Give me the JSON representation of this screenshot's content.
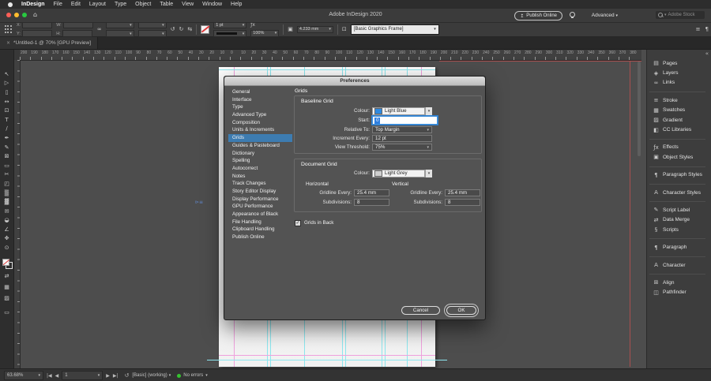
{
  "menu_bar": {
    "items": [
      "InDesign",
      "File",
      "Edit",
      "Layout",
      "Type",
      "Object",
      "Table",
      "View",
      "Window",
      "Help"
    ]
  },
  "title_bar": {
    "title": "Adobe InDesign 2020",
    "publish_online": "Publish Online",
    "advanced": "Advanced",
    "search_placeholder": "Adobe Stock"
  },
  "control_panel": {
    "x_label": "X:",
    "y_label": "Y:",
    "w_label": "W:",
    "h_label": "H:",
    "stroke_weight": "1 pt",
    "opacity": "100%",
    "corner_radius": "4.233 mm",
    "object_style": "[Basic Graphics Frame]"
  },
  "tab_bar": {
    "title": "*Untitled-1 @ 70% [GPU Preview]"
  },
  "rulers": {
    "h_numbers": [
      200,
      190,
      180,
      170,
      160,
      150,
      140,
      130,
      120,
      110,
      100,
      90,
      80,
      70,
      60,
      50,
      40,
      30,
      20,
      10,
      0,
      10,
      20,
      30,
      40,
      50,
      60,
      70,
      80,
      90,
      100,
      110,
      120,
      130,
      140,
      150,
      160,
      170,
      180,
      190,
      200,
      210,
      220,
      230,
      240,
      250,
      260,
      270,
      280,
      290,
      300,
      310,
      320,
      330,
      340,
      350,
      360,
      370,
      380
    ]
  },
  "tools": [
    "selection",
    "direct-selection",
    "page",
    "gap",
    "content-collector",
    "type",
    "line",
    "pen",
    "pencil",
    "rectangle-frame",
    "rectangle",
    "scissors",
    "free-transform",
    "gradient-swatch",
    "gradient-feather",
    "note",
    "eyedropper",
    "measure",
    "hand",
    "zoom"
  ],
  "dialog": {
    "title": "Preferences",
    "nav": {
      "items": [
        {
          "label": "General"
        },
        {
          "label": "Interface"
        },
        {
          "label": "Type"
        },
        {
          "label": "Advanced Type"
        },
        {
          "label": "Composition"
        },
        {
          "label": "Units & Increments"
        },
        {
          "label": "Grids",
          "selected": true
        },
        {
          "label": "Guides & Pasteboard"
        },
        {
          "label": "Dictionary"
        },
        {
          "label": "Spelling"
        },
        {
          "label": "Autocorrect"
        },
        {
          "label": "Notes"
        },
        {
          "label": "Track Changes"
        },
        {
          "label": "Story Editor Display"
        },
        {
          "label": "Display Performance"
        },
        {
          "label": "GPU Performance"
        },
        {
          "label": "Appearance of Black"
        },
        {
          "label": "File Handling"
        },
        {
          "label": "Clipboard Handling"
        },
        {
          "label": "Publish Online"
        }
      ]
    },
    "content": {
      "heading": "Grids",
      "baseline": {
        "title": "Baseline Grid",
        "colour_label": "Colour:",
        "colour_value": "Light Blue",
        "start_label": "Start:",
        "start_value": "0",
        "relative_label": "Relative To:",
        "relative_value": "Top Margin",
        "increment_label": "Increment Every:",
        "increment_value": "12 pt",
        "threshold_label": "View Threshold:",
        "threshold_value": "75%"
      },
      "document": {
        "title": "Document Grid",
        "colour_label": "Colour:",
        "colour_value": "Light Grey",
        "horizontal_title": "Horizontal",
        "vertical_title": "Vertical",
        "h_gridline_label": "Gridline Every:",
        "h_gridline_value": "25.4 mm",
        "h_subdivisions_label": "Subdivisions:",
        "h_subdivisions_value": "8",
        "v_gridline_label": "Gridline Every:",
        "v_gridline_value": "25.4 mm",
        "v_subdivisions_label": "Subdivisions:",
        "v_subdivisions_value": "8"
      },
      "grids_in_back_label": "Grids in Back",
      "grids_in_back_checked": true
    },
    "buttons": {
      "cancel": "Cancel",
      "ok": "OK"
    }
  },
  "right_dock": {
    "items": [
      {
        "icon": "pages",
        "label": "Pages"
      },
      {
        "icon": "layers",
        "label": "Layers"
      },
      {
        "icon": "links",
        "label": "Links"
      },
      {
        "icon": "stroke",
        "label": "Stroke",
        "gap": true
      },
      {
        "icon": "swatches",
        "label": "Swatches"
      },
      {
        "icon": "gradient",
        "label": "Gradient"
      },
      {
        "icon": "cc-libraries",
        "label": "CC Libraries"
      },
      {
        "icon": "effects",
        "label": "Effects",
        "gap": true
      },
      {
        "icon": "object-styles",
        "label": "Object Styles"
      },
      {
        "icon": "paragraph-styles",
        "label": "Paragraph Styles",
        "gap": true
      },
      {
        "icon": "character-styles",
        "label": "Character Styles",
        "gap": true
      },
      {
        "icon": "script-label",
        "label": "Script Label",
        "gap": true
      },
      {
        "icon": "data-merge",
        "label": "Data Merge"
      },
      {
        "icon": "scripts",
        "label": "Scripts"
      },
      {
        "icon": "paragraph",
        "label": "Paragraph",
        "gap": true
      },
      {
        "icon": "character",
        "label": "Character",
        "gap": true
      },
      {
        "icon": "align",
        "label": "Align",
        "gap": true
      },
      {
        "icon": "pathfinder",
        "label": "Pathfinder"
      }
    ]
  },
  "status_bar": {
    "zoom": "63.68%",
    "page": "1",
    "preflight": "[Basic] (working)",
    "errors": "No errors"
  },
  "colors": {
    "selection_blue": "#3d7cb1",
    "light_blue_swatch": "#2f8ae0",
    "light_grey_swatch": "#cfcfcf",
    "traffic_red": "#ff5f57",
    "traffic_yellow": "#febc2e",
    "traffic_green": "#28c840",
    "no_errors_green": "#35c42f",
    "guide_cyan": "#8ce6ee",
    "guide_magenta": "#efa0dd"
  }
}
